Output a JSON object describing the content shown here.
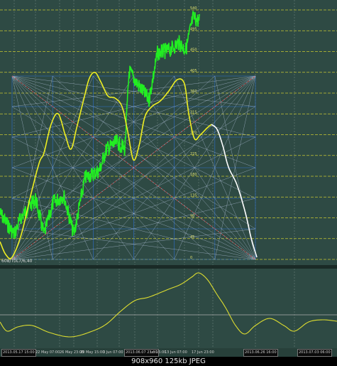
{
  "colors": {
    "background": "#2e4a44",
    "price_line": "#22ee22",
    "cycle_curve": "#eeee22",
    "cycle_curve_future": "#ffffff",
    "gann_grid": "#3070d0",
    "gann_grid_light": "#b0c0d8",
    "gann_diagonal": "#b04040",
    "level_line": "#c8c830",
    "oscillator": "#dddd30"
  },
  "main_chart": {
    "indicator_label": "608/T0L7/6,40",
    "level_labels": [
      "540",
      "495",
      "450",
      "405",
      "360",
      "315",
      "270",
      "225",
      "180",
      "135",
      "90",
      "45",
      "0"
    ]
  },
  "time_axis": {
    "labels": [
      {
        "text": "2013.05.17 15:00",
        "boxed": true
      },
      {
        "text": "22 May 07:00",
        "boxed": false
      },
      {
        "text": "26 May 23:00",
        "boxed": false
      },
      {
        "text": "29 May 15:00",
        "boxed": false
      },
      {
        "text": "3 Jun 07:00",
        "boxed": false
      },
      {
        "text": "2013.06.07 23:00",
        "boxed": true
      },
      {
        "text": "un 15:00",
        "boxed": false
      },
      {
        "text": "13 Jun 07:00",
        "boxed": false
      },
      {
        "text": "17 Jun 23:00",
        "boxed": false
      },
      {
        "text": "2013.06.26 16:00",
        "boxed": true
      },
      {
        "text": "2013.07.03 06:00",
        "boxed": true
      }
    ]
  },
  "footer": {
    "text": "908x960  125kb  JPEG"
  }
}
